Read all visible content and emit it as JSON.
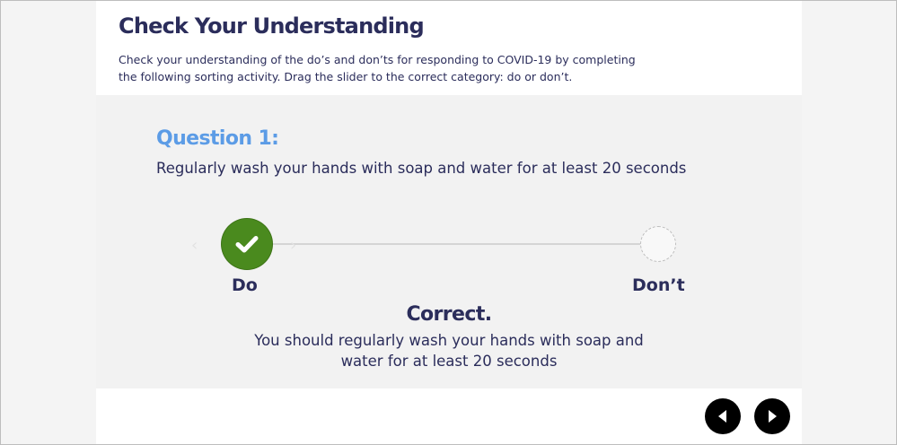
{
  "header": {
    "title": "Check Your Understanding",
    "subtitle": "Check your understanding of the do’s and don’ts for responding to COVID-19 by completing the following sorting activity. Drag the slider to the correct category: do or don’t."
  },
  "question": {
    "heading": "Question 1:",
    "text": "Regularly wash your hands with soap and water for at least 20 seconds"
  },
  "slider": {
    "left_label": "Do",
    "right_label": "Don’t",
    "handle_icon": "checkmark-icon",
    "selected": "Do"
  },
  "feedback": {
    "title": "Correct.",
    "text": "You should regularly wash your hands with soap and water for at least 20 seconds"
  },
  "navigation": {
    "prev_icon": "triangle-left-icon",
    "next_icon": "triangle-right-icon"
  },
  "colors": {
    "title": "#2b2d5b",
    "question_heading": "#5c9ce6",
    "correct_green": "#4a8a1e",
    "panel_bg": "#f2f2f2"
  }
}
